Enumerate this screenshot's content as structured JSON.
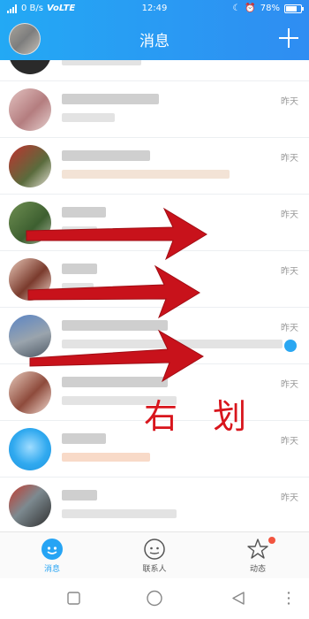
{
  "status_bar": {
    "network": "0 B/s",
    "carrier": "VoLTE",
    "time": "12:49",
    "battery": "78%",
    "battery_level": 0.78
  },
  "header": {
    "title": "消息",
    "plus_icon": "plus-icon"
  },
  "conversations": [
    {
      "time": ""
    },
    {
      "time": "昨天"
    },
    {
      "time": "昨天"
    },
    {
      "time": "昨天"
    },
    {
      "time": "昨天"
    },
    {
      "time": "昨天"
    },
    {
      "time": "昨天"
    },
    {
      "time": "昨天"
    },
    {
      "time": "昨天"
    }
  ],
  "bottom_nav": {
    "tabs": [
      {
        "label": "消息",
        "icon": "message-icon",
        "active": true
      },
      {
        "label": "联系人",
        "icon": "contacts-icon",
        "active": false
      },
      {
        "label": "动态",
        "icon": "star-icon",
        "active": false
      }
    ]
  },
  "annotation": {
    "text": "右 划",
    "color": "#d8151c"
  },
  "colors": {
    "header_gradient_start": "#23a9f4",
    "header_gradient_end": "#2f8df2",
    "accent": "#26a4f4",
    "badge_dot": "#f2543f"
  }
}
